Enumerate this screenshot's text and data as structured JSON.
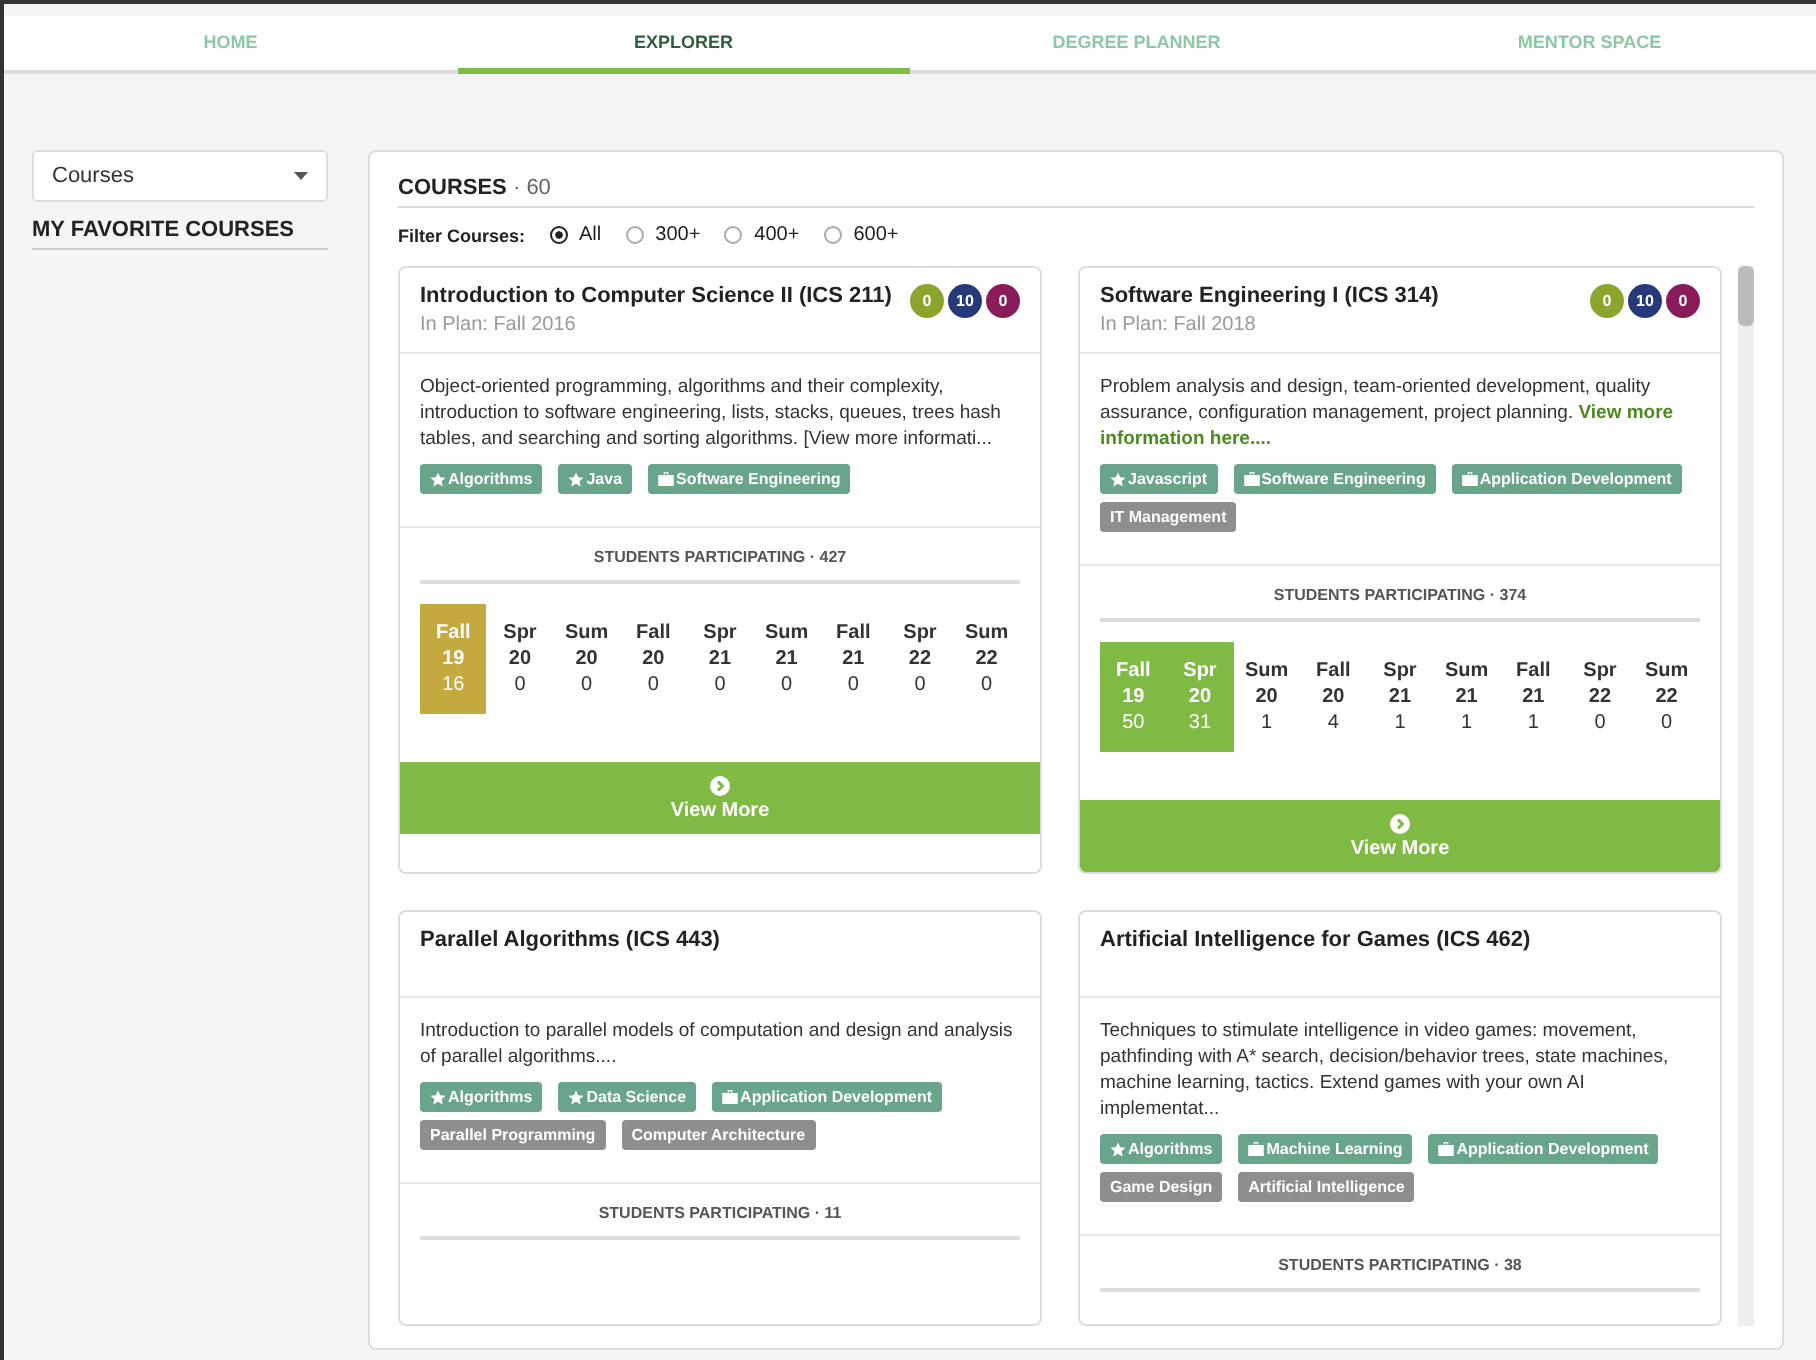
{
  "tabs": [
    {
      "label": "HOME",
      "selected": false
    },
    {
      "label": "EXPLORER",
      "selected": true
    },
    {
      "label": "DEGREE PLANNER",
      "selected": false
    },
    {
      "label": "MENTOR SPACE",
      "selected": false
    }
  ],
  "sidebar": {
    "dropdown": {
      "value": "Courses"
    },
    "heading": "MY FAVORITE COURSES"
  },
  "panel": {
    "title": "COURSES",
    "count": "· 60",
    "filter_label": "Filter Courses:",
    "filters": [
      {
        "label": "All",
        "selected": true
      },
      {
        "label": "300+",
        "selected": false
      },
      {
        "label": "400+",
        "selected": false
      },
      {
        "label": "600+",
        "selected": false
      }
    ],
    "cards": [
      {
        "title": "Introduction to Computer Science II (ICS 211)",
        "plan": "In Plan: Fall 2016",
        "badges": [
          {
            "label": "0",
            "color": "#8aa52c"
          },
          {
            "label": "10",
            "color": "#263a7a"
          },
          {
            "label": "0",
            "color": "#8a1c5c"
          }
        ],
        "description": "Object-oriented programming, algorithms and their complexity, introduction to software engineering, lists, stacks, queues, trees hash tables, and searching and sorting algorithms. [View more informati...",
        "tags": [
          {
            "label": "Algorithms",
            "kind": "star"
          },
          {
            "label": "Java",
            "kind": "star"
          },
          {
            "label": "Software Engineering",
            "kind": "career"
          }
        ],
        "participating": "STUDENTS PARTICIPATING · 427",
        "terms": [
          {
            "term": "Fall",
            "year": "19",
            "count": "16",
            "color": "#c4a93f"
          },
          {
            "term": "Spr",
            "year": "20",
            "count": "0"
          },
          {
            "term": "Sum",
            "year": "20",
            "count": "0"
          },
          {
            "term": "Fall",
            "year": "20",
            "count": "0"
          },
          {
            "term": "Spr",
            "year": "21",
            "count": "0"
          },
          {
            "term": "Sum",
            "year": "21",
            "count": "0"
          },
          {
            "term": "Fall",
            "year": "21",
            "count": "0"
          },
          {
            "term": "Spr",
            "year": "22",
            "count": "0"
          },
          {
            "term": "Sum",
            "year": "22",
            "count": "0"
          }
        ],
        "button": "View More"
      },
      {
        "title": "Software Engineering I (ICS 314)",
        "plan": "In Plan: Fall 2018",
        "badges": [
          {
            "label": "0",
            "color": "#8aa52c"
          },
          {
            "label": "10",
            "color": "#263a7a"
          },
          {
            "label": "0",
            "color": "#8a1c5c"
          }
        ],
        "description": "Problem analysis and design, team-oriented development, quality assurance, configuration management, project planning. **View more information here....**",
        "tags": [
          {
            "label": "Javascript",
            "kind": "star"
          },
          {
            "label": "Software Engineering",
            "kind": "career"
          },
          {
            "label": "Application Development",
            "kind": "career"
          },
          {
            "label": "IT Management",
            "kind": "plain"
          }
        ],
        "participating": "STUDENTS PARTICIPATING · 374",
        "terms": [
          {
            "term": "Fall",
            "year": "19",
            "count": "50",
            "color": "#7fba45"
          },
          {
            "term": "Spr",
            "year": "20",
            "count": "31",
            "color": "#7fba45"
          },
          {
            "term": "Sum",
            "year": "20",
            "count": "1"
          },
          {
            "term": "Fall",
            "year": "20",
            "count": "4"
          },
          {
            "term": "Spr",
            "year": "21",
            "count": "1"
          },
          {
            "term": "Sum",
            "year": "21",
            "count": "1"
          },
          {
            "term": "Fall",
            "year": "21",
            "count": "1"
          },
          {
            "term": "Spr",
            "year": "22",
            "count": "0"
          },
          {
            "term": "Sum",
            "year": "22",
            "count": "0"
          }
        ],
        "button": "View More"
      },
      {
        "title": "Parallel Algorithms (ICS 443)",
        "description": "Introduction to parallel models of computation and design and analysis of parallel algorithms....",
        "tags": [
          {
            "label": "Algorithms",
            "kind": "star"
          },
          {
            "label": "Data Science",
            "kind": "star"
          },
          {
            "label": "Application Development",
            "kind": "career"
          },
          {
            "label": "Parallel Programming",
            "kind": "plain"
          },
          {
            "label": "Computer Architecture",
            "kind": "plain"
          }
        ],
        "participating": "STUDENTS PARTICIPATING · 11"
      },
      {
        "title": "Artificial Intelligence for Games (ICS 462)",
        "description": "Techniques to stimulate intelligence in video games: movement, pathfinding with A* search, decision/behavior trees, state machines, machine learning, tactics. Extend games with your own AI implementat...",
        "tags": [
          {
            "label": "Algorithms",
            "kind": "star"
          },
          {
            "label": "Machine Learning",
            "kind": "career"
          },
          {
            "label": "Application Development",
            "kind": "career"
          },
          {
            "label": "Game Design",
            "kind": "plain"
          },
          {
            "label": "Artificial Intelligence",
            "kind": "plain"
          }
        ],
        "participating": "STUDENTS PARTICIPATING · 38"
      }
    ]
  }
}
